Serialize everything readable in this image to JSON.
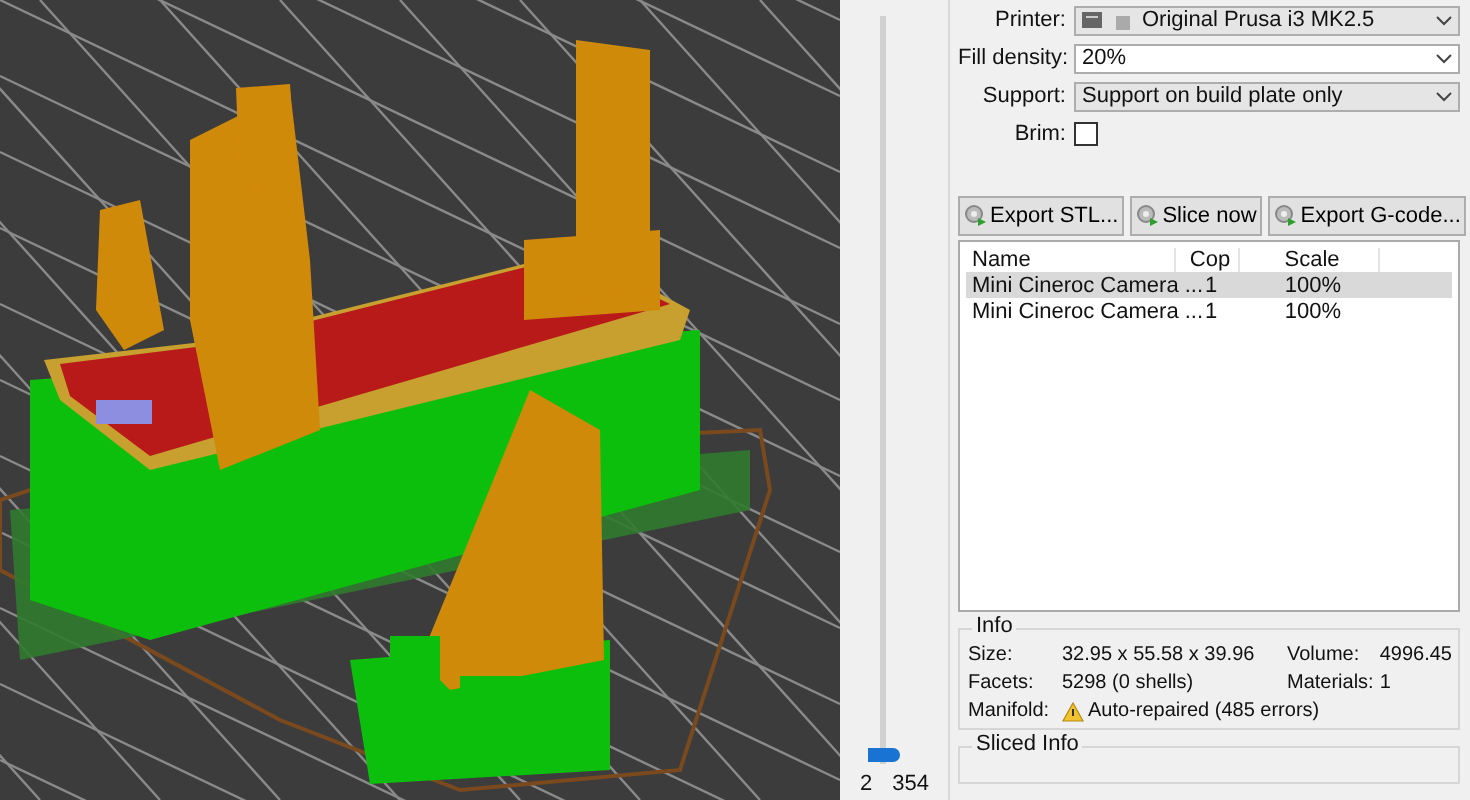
{
  "settings": [
    {
      "kind": "printer",
      "label": "Printer:",
      "value": "Original Prusa i3 MK2.5"
    },
    {
      "kind": "combo",
      "label": "Fill density:",
      "value": "20%"
    },
    {
      "kind": "choice",
      "label": "Support:",
      "value": "Support on build plate only"
    },
    {
      "kind": "checkbox",
      "label": "Brim:",
      "checked": false
    }
  ],
  "actions": [
    "Export STL...",
    "Slice now",
    "Export G-code..."
  ],
  "objects": {
    "columns": [
      "Name",
      "Cop",
      "Scale"
    ],
    "rows": [
      {
        "cells": [
          "Mini Cineroc Camera ...",
          "1",
          "100%"
        ],
        "selected": true
      },
      {
        "cells": [
          "Mini Cineroc Camera ...",
          "1",
          "100%"
        ],
        "selected": false
      }
    ]
  },
  "info": {
    "title": "Info",
    "size_label": "Size:",
    "size": "32.95 x 55.58 x 39.96",
    "volume_label": "Volume:",
    "volume": "4996.45",
    "facets_label": "Facets:",
    "facets": "5298 (0 shells)",
    "materials_label": "Materials:",
    "materials": "1",
    "manifold_label": "Manifold:",
    "manifold": "Auto-repaired (485 errors)"
  },
  "sliced_info": {
    "title": "Sliced Info"
  },
  "layer_slider": {
    "level": 0.01,
    "low": "2",
    "high": "354"
  }
}
